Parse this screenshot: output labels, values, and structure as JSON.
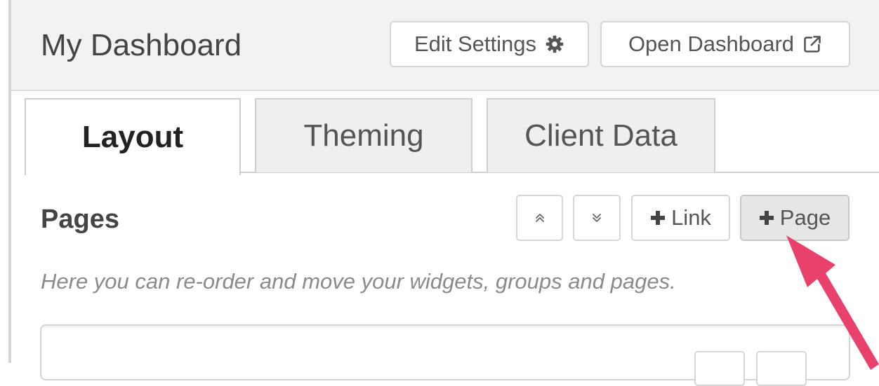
{
  "header": {
    "title": "My Dashboard",
    "edit_settings_label": "Edit Settings",
    "edit_settings_icon": "gear-icon",
    "open_dashboard_label": "Open Dashboard",
    "open_dashboard_icon": "external-link-icon"
  },
  "tabs": [
    {
      "label": "Layout",
      "active": true
    },
    {
      "label": "Theming",
      "active": false
    },
    {
      "label": "Client Data",
      "active": false
    }
  ],
  "pages_section": {
    "title": "Pages",
    "move_up_icon": "double-chevron-up-icon",
    "move_down_icon": "double-chevron-down-icon",
    "add_link_label": "Link",
    "add_page_label": "Page",
    "hint": "Here you can re-order and move your widgets, groups and pages."
  },
  "colors": {
    "annotation_arrow": "#e8426c",
    "header_bg": "#f2f2f2",
    "inactive_tab_bg": "#efefef"
  }
}
